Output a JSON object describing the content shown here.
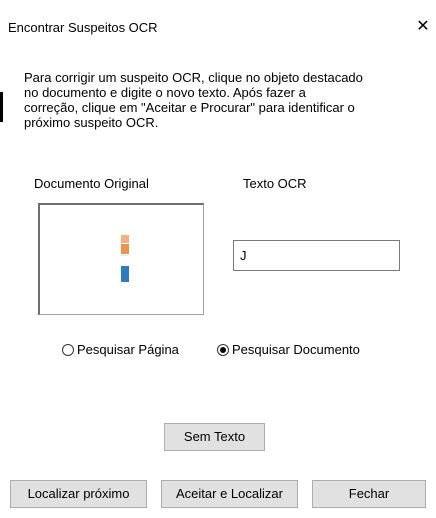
{
  "window": {
    "title": "Encontrar Suspeitos OCR",
    "close_glyph": "✕"
  },
  "instructions": "Para corrigir um suspeito OCR, clique no objeto destacado\nno documento e digite o novo texto. Após fazer a\ncorreção, clique em \"Aceitar e Procurar\" para identificar o\npróximo suspeito OCR.",
  "labels": {
    "original_document": "Documento Original",
    "ocr_text": "Texto OCR"
  },
  "ocr_field": {
    "value": "J"
  },
  "search_scope": {
    "options": [
      {
        "label": "Pesquisar Página",
        "checked": false
      },
      {
        "label": "Pesquisar Documento",
        "checked": true
      }
    ]
  },
  "buttons": {
    "no_text": "Sem Texto",
    "find_next": "Localizar próximo",
    "accept_and_find": "Aceitar e Localizar",
    "close": "Fechar"
  },
  "colors": {
    "button_face": "#e1e1e1",
    "button_border": "#adadad",
    "glyph_orange": "#e8954f",
    "glyph_blue": "#2f7bc0"
  }
}
